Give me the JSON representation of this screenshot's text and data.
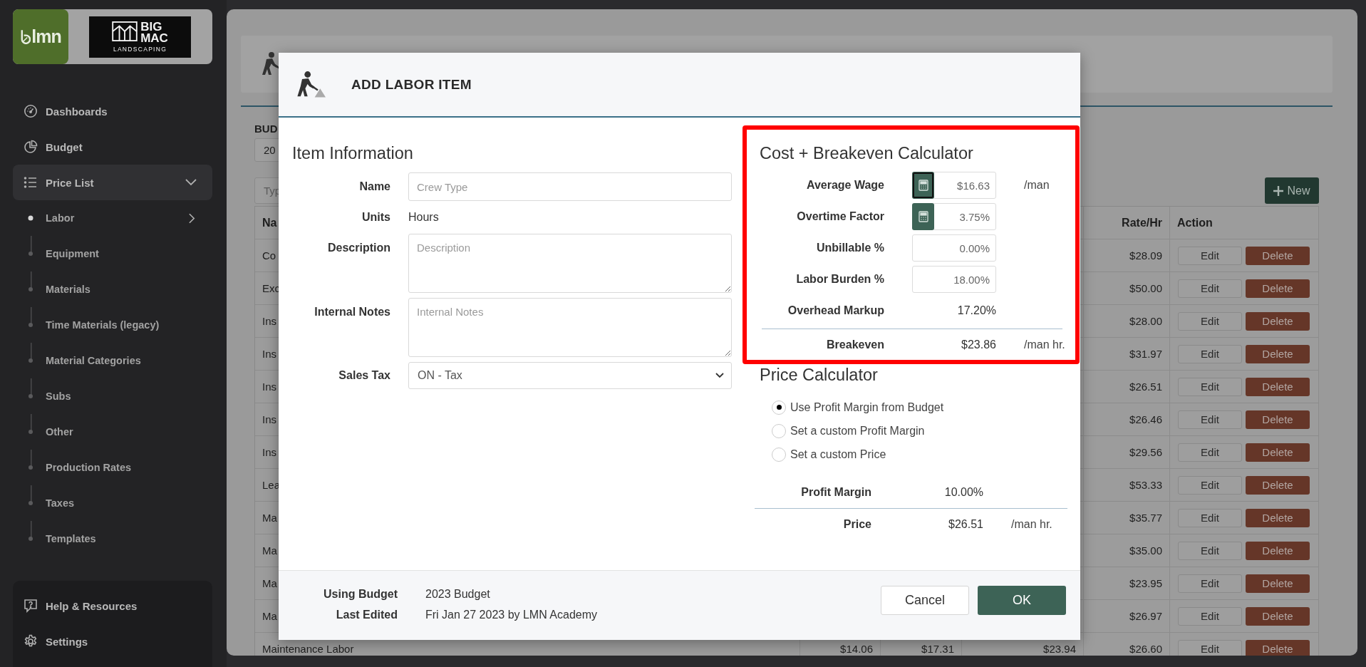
{
  "sidebar": {
    "logo": {
      "brand": "lmn",
      "company_lines": [
        "BIG",
        "MAC",
        "LANDSCAPING"
      ]
    },
    "nav": [
      {
        "label": "Dashboards",
        "selected": false
      },
      {
        "label": "Budget",
        "selected": false
      },
      {
        "label": "Price List",
        "selected": true,
        "expanded": true,
        "children": [
          {
            "label": "Labor",
            "selected": true
          },
          {
            "label": "Equipment",
            "selected": false
          },
          {
            "label": "Materials",
            "selected": false
          },
          {
            "label": "Time Materials (legacy)",
            "selected": false
          },
          {
            "label": "Material Categories",
            "selected": false
          },
          {
            "label": "Subs",
            "selected": false
          },
          {
            "label": "Other",
            "selected": false
          },
          {
            "label": "Production Rates",
            "selected": false
          },
          {
            "label": "Taxes",
            "selected": false
          },
          {
            "label": "Templates",
            "selected": false
          }
        ]
      }
    ],
    "bottom_nav": [
      {
        "label": "Help & Resources"
      },
      {
        "label": "Settings"
      }
    ]
  },
  "page": {
    "budget_label": "BUD",
    "budget_value": "20",
    "filter_placeholder": "Typ",
    "new_button": "New",
    "columns": {
      "column_1": "Na",
      "rate": "Rate/Hr",
      "action": "Action"
    },
    "rows": [
      {
        "name": "Co",
        "rate": "$28.09",
        "edit": "Edit",
        "delete": "Delete"
      },
      {
        "name": "Exc",
        "rate": "$50.00",
        "edit": "Edit",
        "delete": "Delete"
      },
      {
        "name": "Ins",
        "rate": "$28.00",
        "edit": "Edit",
        "delete": "Delete"
      },
      {
        "name": "Ins",
        "rate": "$31.97",
        "edit": "Edit",
        "delete": "Delete"
      },
      {
        "name": "Ins",
        "rate": "$26.51",
        "edit": "Edit",
        "delete": "Delete"
      },
      {
        "name": "Ins",
        "rate": "$26.46",
        "edit": "Edit",
        "delete": "Delete"
      },
      {
        "name": "Ins",
        "rate": "$29.56",
        "edit": "Edit",
        "delete": "Delete"
      },
      {
        "name": "Lea",
        "rate": "$53.33",
        "edit": "Edit",
        "delete": "Delete"
      },
      {
        "name": "Ma",
        "rate": "$35.77",
        "edit": "Edit",
        "delete": "Delete"
      },
      {
        "name": "Ma",
        "rate": "$35.00",
        "edit": "Edit",
        "delete": "Delete"
      },
      {
        "name": "Ma",
        "rate": "$23.95",
        "edit": "Edit",
        "delete": "Delete"
      },
      {
        "name": "Ma",
        "rate": "$26.97",
        "edit": "Edit",
        "delete": "Delete"
      },
      {
        "name": "Maintenance Labor",
        "column_2": "$14.06",
        "column_3": "$17.31",
        "column_4": "$23.94",
        "rate": "$26.60",
        "edit": "Edit",
        "delete": "Delete"
      }
    ]
  },
  "modal": {
    "title": "ADD LABOR ITEM",
    "item_information": {
      "heading": "Item Information",
      "fields": [
        {
          "kind": "input",
          "label": "Name",
          "placeholder": "Crew Type"
        },
        {
          "kind": "text",
          "label": "Units",
          "value": "Hours"
        },
        {
          "kind": "textarea",
          "label": "Description",
          "placeholder": "Description"
        },
        {
          "kind": "textarea",
          "label": "Internal Notes",
          "placeholder": "Internal Notes"
        },
        {
          "kind": "select",
          "label": "Sales Tax",
          "value": "ON - Tax"
        }
      ]
    },
    "cost_calculator": {
      "heading": "Cost + Breakeven Calculator",
      "highlighted": true,
      "rows": [
        {
          "kind": "calc_input",
          "label": "Average Wage",
          "value": "$16.63",
          "unit": "/man",
          "focused": true
        },
        {
          "kind": "calc_input",
          "label": "Overtime Factor",
          "value": "3.75%",
          "focused": false
        },
        {
          "kind": "input",
          "label": "Unbillable %",
          "value": "0.00%"
        },
        {
          "kind": "input",
          "label": "Labor Burden %",
          "value": "18.00%"
        },
        {
          "kind": "text",
          "label": "Overhead Markup",
          "value": "17.20%"
        },
        {
          "kind": "total",
          "label": "Breakeven",
          "value": "$23.86",
          "unit": "/man hr."
        }
      ]
    },
    "price_calculator": {
      "heading": "Price Calculator",
      "options": [
        {
          "label": "Use Profit Margin from Budget",
          "selected": true
        },
        {
          "label": "Set a custom Profit Margin",
          "selected": false
        },
        {
          "label": "Set a custom Price",
          "selected": false
        }
      ],
      "rows": [
        {
          "kind": "text",
          "label": "Profit Margin",
          "value": "10.00%"
        },
        {
          "kind": "total",
          "label": "Price",
          "value": "$26.51",
          "unit": "/man hr."
        }
      ]
    },
    "footer": {
      "info": [
        {
          "label": "Using Budget",
          "value": "2023 Budget"
        },
        {
          "label": "Last Edited",
          "value": "Fri Jan 27 2023 by LMN Academy"
        }
      ],
      "buttons": [
        {
          "label": "Cancel",
          "kind": "secondary"
        },
        {
          "label": "OK",
          "kind": "primary"
        }
      ]
    }
  }
}
